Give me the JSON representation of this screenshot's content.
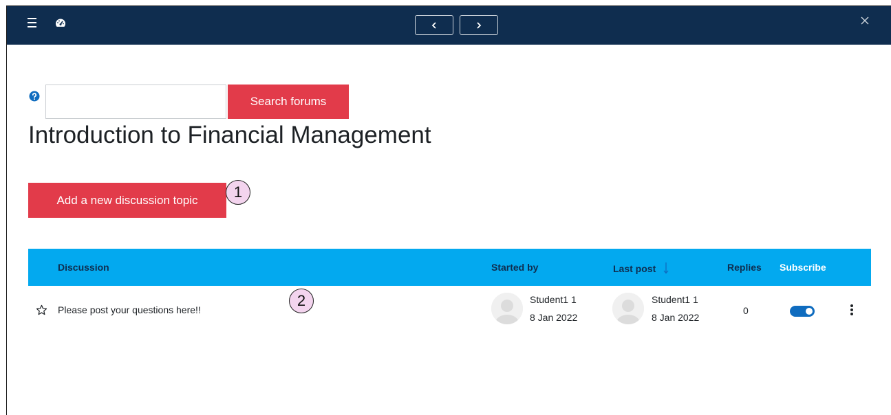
{
  "colors": {
    "topbar": "#0f2d4f",
    "primary_button": "#e23b4a",
    "table_header": "#03a9ef",
    "toggle_on": "#0f6cbf",
    "callout": "#f3d4ee"
  },
  "topbar": {
    "menu_icon": "hamburger-icon",
    "dashboard_icon": "dashboard-icon",
    "prev_icon": "chevron-left-icon",
    "next_icon": "chevron-right-icon",
    "close_icon": "close-icon"
  },
  "search": {
    "help_icon": "question-circle-icon",
    "value": "",
    "placeholder": "",
    "button_label": "Search forums"
  },
  "page": {
    "title": "Introduction to Financial Management",
    "add_button_label": "Add a new discussion topic"
  },
  "callouts": [
    "1",
    "2"
  ],
  "table": {
    "headers": {
      "discussion": "Discussion",
      "started_by": "Started by",
      "last_post": "Last post",
      "replies": "Replies",
      "subscribe": "Subscribe"
    },
    "sort": {
      "column": "last_post",
      "direction": "descending"
    },
    "rows": [
      {
        "starred": false,
        "title": "Please post your questions here!!",
        "started_by": {
          "name": "Student1 1",
          "date": "8 Jan 2022"
        },
        "last_post": {
          "name": "Student1 1",
          "date": "8 Jan 2022"
        },
        "replies": "0",
        "subscribed": true
      }
    ]
  }
}
